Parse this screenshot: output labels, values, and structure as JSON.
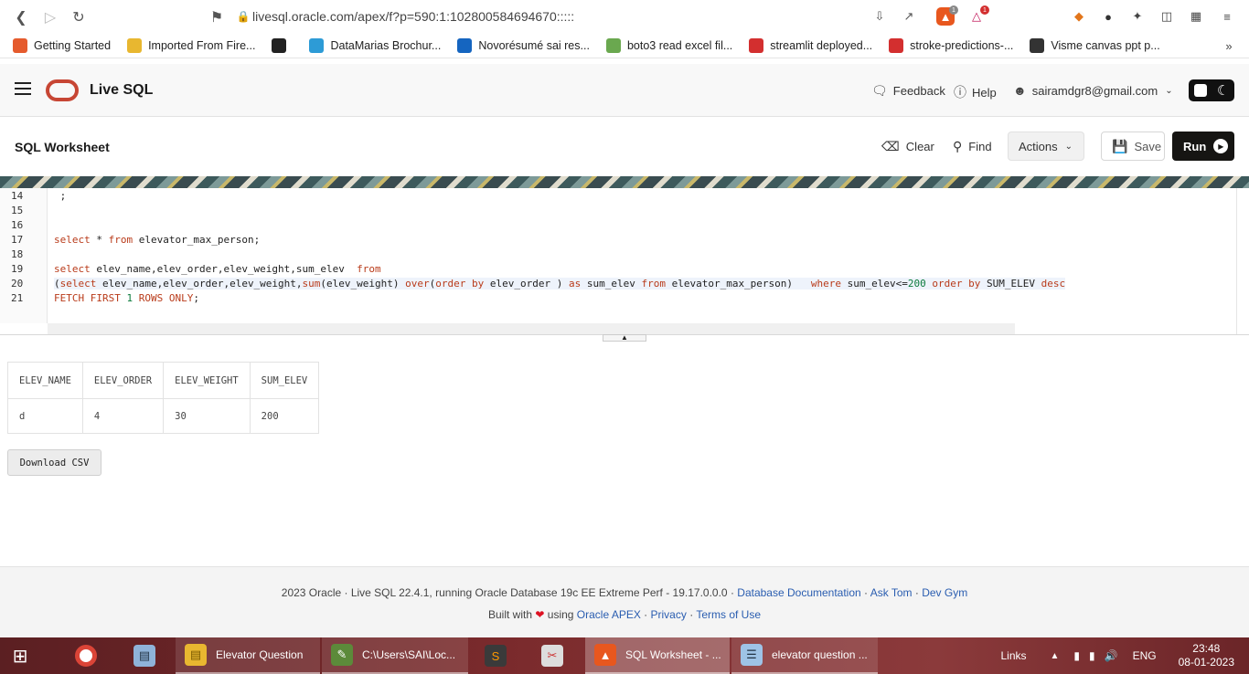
{
  "browser": {
    "url": "livesql.oracle.com/apex/f?p=590:1:102800584694670:::::",
    "bookmarks": [
      {
        "label": "Getting Started",
        "icon": "firefox-icon",
        "color": "#e55b2d"
      },
      {
        "label": "Imported From Fire...",
        "icon": "folder-icon",
        "color": "#e8b730"
      },
      {
        "label": "",
        "icon": "github-icon",
        "color": "#222222"
      },
      {
        "label": "DataMarias Brochur...",
        "icon": "canva-icon",
        "color": "#2d9bd6"
      },
      {
        "label": "Novorésumé sai res...",
        "icon": "novoresume-icon",
        "color": "#1565c0"
      },
      {
        "label": "boto3 read excel fil...",
        "icon": "plant-icon",
        "color": "#6aa84f"
      },
      {
        "label": "streamlit deployed...",
        "icon": "streamlit-icon",
        "color": "#d32f2f"
      },
      {
        "label": "stroke-predictions-...",
        "icon": "streamlit-icon",
        "color": "#d32f2f"
      },
      {
        "label": "Visme canvas ppt p...",
        "icon": "visme-icon",
        "color": "#333333"
      }
    ],
    "brave_badge": "1",
    "alert_badge": "1"
  },
  "header": {
    "app_title": "Live SQL",
    "feedback": "Feedback",
    "help": "Help",
    "user_email": "sairamdgr8@gmail.com"
  },
  "toolbar": {
    "title": "SQL Worksheet",
    "clear": "Clear",
    "find": "Find",
    "actions": "Actions",
    "save": "Save",
    "run": "Run"
  },
  "editor": {
    "line_numbers": [
      "14",
      "15",
      "16",
      "17",
      "18",
      "19",
      "20",
      "21"
    ],
    "lines": [
      " ;",
      "",
      "",
      "select * from elevator_max_person;",
      "",
      "select elev_name,elev_order,elev_weight,sum_elev  from",
      "(select elev_name,elev_order,elev_weight,sum(elev_weight) over(order by elev_order ) as sum_elev from elevator_max_person)   where sum_elev<=200 order by SUM_ELEV desc",
      "FETCH FIRST 1 ROWS ONLY;"
    ]
  },
  "results": {
    "columns": [
      "ELEV_NAME",
      "ELEV_ORDER",
      "ELEV_WEIGHT",
      "SUM_ELEV"
    ],
    "rows": [
      [
        "d",
        "4",
        "30",
        "200"
      ]
    ],
    "download": "Download CSV"
  },
  "footer": {
    "version_text": "2023 Oracle · Live SQL 22.4.1, running Oracle Database 19c EE Extreme Perf - 19.17.0.0.0 ·",
    "db_docs": "Database Documentation",
    "sep1": "·",
    "ask_tom": "Ask Tom",
    "sep2": "·",
    "dev_gym": "Dev Gym",
    "built_with": "Built with",
    "using": "using",
    "apex": "Oracle APEX",
    "sep3": "·",
    "privacy": "Privacy",
    "sep4": "·",
    "terms": "Terms of Use"
  },
  "taskbar": {
    "apps": [
      {
        "label": "Elevator Question",
        "icon": "folder-icon"
      },
      {
        "label": "C:\\Users\\SAI\\Loc...",
        "icon": "editor-icon"
      },
      {
        "label": "SQL Worksheet - ...",
        "icon": "brave-icon"
      },
      {
        "label": "elevator question ...",
        "icon": "notepad-icon"
      }
    ],
    "links": "Links",
    "lang": "ENG",
    "time": "23:48",
    "date": "08-01-2023"
  }
}
